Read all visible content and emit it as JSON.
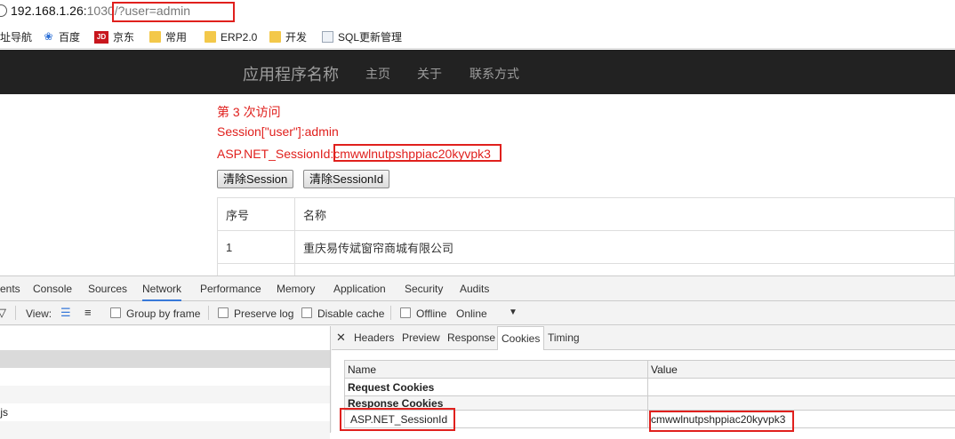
{
  "address_bar": {
    "host": "192.168.1.26:",
    "port": "1030",
    "path": "/?user=admin"
  },
  "bookmarks": [
    {
      "label": "址导航",
      "icon": "none"
    },
    {
      "label": "百度",
      "icon": "baidu-icon"
    },
    {
      "label": "京东",
      "icon": "jd-icon",
      "icon_text": "JD"
    },
    {
      "label": "常用",
      "icon": "folder-icon"
    },
    {
      "label": "ERP2.0",
      "icon": "folder-icon"
    },
    {
      "label": "开发",
      "icon": "folder-icon"
    },
    {
      "label": "SQL更新管理",
      "icon": "page-icon"
    }
  ],
  "navbar": {
    "brand": "应用程序名称",
    "links": [
      "主页",
      "关于",
      "联系方式"
    ]
  },
  "content": {
    "visit_text": "第 3 次访问",
    "session_user": "Session[\"user\"]:admin",
    "session_id_label": "ASP.NET_SessionId:",
    "session_id_value": "cmwwlnutpshppiac20kyvpk3",
    "buttons": [
      "清除Session",
      "清除SessionId"
    ],
    "table": {
      "headers": [
        "序号",
        "名称"
      ],
      "rows": [
        [
          "1",
          "重庆易传斌窗帘商城有限公司"
        ]
      ]
    }
  },
  "devtools": {
    "tabs": [
      "ents",
      "Console",
      "Sources",
      "Network",
      "Performance",
      "Memory",
      "Application",
      "Security",
      "Audits"
    ],
    "active_tab": "Network",
    "toolbar": {
      "view_label": "View:",
      "group_by_frame": "Group by frame",
      "preserve_log": "Preserve log",
      "disable_cache": "Disable cache",
      "offline": "Offline",
      "throttle": "Online"
    },
    "left_rows": [
      "",
      "",
      "",
      ".js",
      ""
    ],
    "detail_tabs": [
      "Headers",
      "Preview",
      "Response",
      "Cookies",
      "Timing"
    ],
    "active_detail_tab": "Cookies",
    "cookies": {
      "columns": [
        "Name",
        "Value"
      ],
      "request_group": "Request Cookies",
      "response_group": "Response Cookies",
      "row": {
        "name": "ASP.NET_SessionId",
        "value": "cmwwlnutpshppiac20kyvpk3"
      }
    }
  },
  "colors": {
    "highlight": "#e0201d",
    "navbar_bg": "#222222",
    "active_tab": "#3879d9"
  }
}
